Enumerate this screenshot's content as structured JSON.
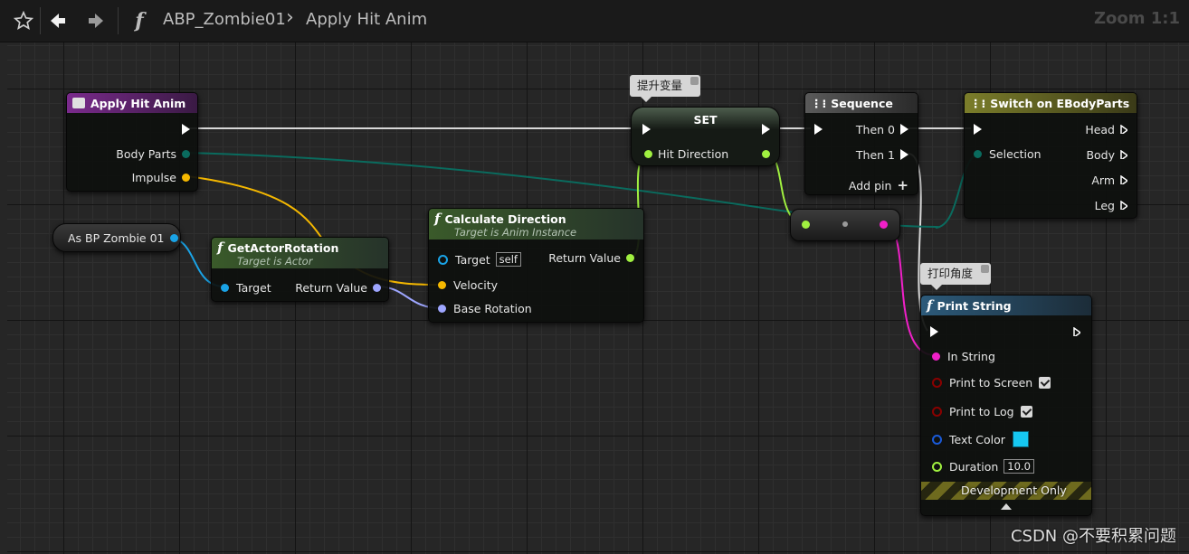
{
  "toolbar": {
    "breadcrumb_root": "ABP_Zombie01",
    "breadcrumb_separator": "›",
    "breadcrumb_current": "Apply Hit Anim",
    "zoom": "Zoom 1:1"
  },
  "nodes": {
    "apply_hit_anim": {
      "title": "Apply Hit Anim",
      "pins": {
        "body_parts": "Body Parts",
        "impulse": "Impulse"
      }
    },
    "as_bp_zombie": {
      "title": "As BP Zombie 01"
    },
    "get_actor_rotation": {
      "title": "GetActorRotation",
      "subtitle": "Target is Actor",
      "pins": {
        "target": "Target",
        "return_value": "Return Value"
      }
    },
    "calculate_direction": {
      "title": "Calculate Direction",
      "subtitle": "Target is Anim Instance",
      "pins": {
        "target": "Target",
        "target_default": "self",
        "return_value": "Return Value",
        "velocity": "Velocity",
        "base_rotation": "Base Rotation"
      }
    },
    "set": {
      "title": "SET",
      "comment": "提升变量",
      "pins": {
        "hit_direction": "Hit Direction"
      }
    },
    "sequence": {
      "title": "Sequence",
      "pins": {
        "then0": "Then 0",
        "then1": "Then 1",
        "add_pin": "Add pin"
      }
    },
    "switch": {
      "title": "Switch on EBodyParts",
      "pins": {
        "selection": "Selection",
        "head": "Head",
        "body": "Body",
        "arm": "Arm",
        "leg": "Leg"
      }
    },
    "print_string": {
      "title": "Print String",
      "comment": "打印角度",
      "pins": {
        "in_string": "In String",
        "print_to_screen": "Print to Screen",
        "print_to_log": "Print to Log",
        "text_color": "Text Color",
        "duration": "Duration",
        "duration_value": "10.0"
      },
      "footer": "Development Only",
      "text_color_value": "#16c8f2"
    }
  },
  "watermark": "CSDN @不要积累问题",
  "colors": {
    "exec": "#ffffff",
    "enum_pin": "#0a6b5e",
    "struct_pin": "#f5b800",
    "object_pin": "#1aa3e6",
    "rotator_pin": "#9ea6ff",
    "float_pin": "#a0f040",
    "string_pin": "#f020c8",
    "bool_pin": "#8a0000",
    "purple_header": "#7a2a8c",
    "green_header": "#3a5a2a",
    "grey_header": "#4e4e4e",
    "olive_header": "#7b7d2a",
    "blue_header": "#2c5a7a"
  }
}
